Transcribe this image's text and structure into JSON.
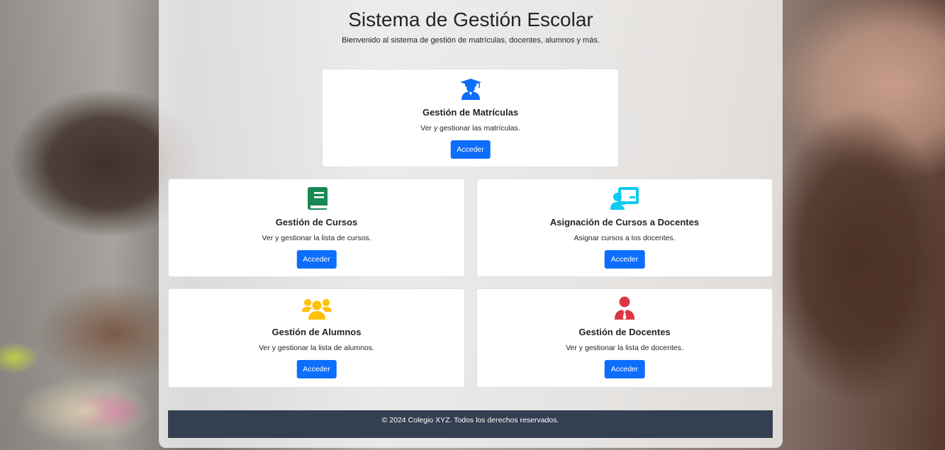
{
  "header": {
    "title": "Sistema de Gestión Escolar",
    "subtitle": "Bienvenido al sistema de gestión de matrículas, docentes, alumnos y más."
  },
  "cards": [
    {
      "icon": "graduate-icon",
      "icon_color": "#0d6efd",
      "title": "Gestión de Matrículas",
      "text": "Ver y gestionar las matrículas.",
      "button": "Acceder"
    },
    {
      "icon": "book-icon",
      "icon_color": "#198754",
      "title": "Gestión de Cursos",
      "text": "Ver y gestionar la lista de cursos.",
      "button": "Acceder"
    },
    {
      "icon": "teacher-board-icon",
      "icon_color": "#0dcaf0",
      "title": "Asignación de Cursos a Docentes",
      "text": "Asignar cursos a los docentes.",
      "button": "Acceder"
    },
    {
      "icon": "users-icon",
      "icon_color": "#ffc107",
      "title": "Gestión de Alumnos",
      "text": "Ver y gestionar la lista de alumnos.",
      "button": "Acceder"
    },
    {
      "icon": "user-tie-icon",
      "icon_color": "#dc3545",
      "title": "Gestión de Docentes",
      "text": "Ver y gestionar la lista de docentes.",
      "button": "Acceder"
    }
  ],
  "footer": {
    "text": "© 2024 Colegio XYZ. Todos los derechos reservados."
  }
}
